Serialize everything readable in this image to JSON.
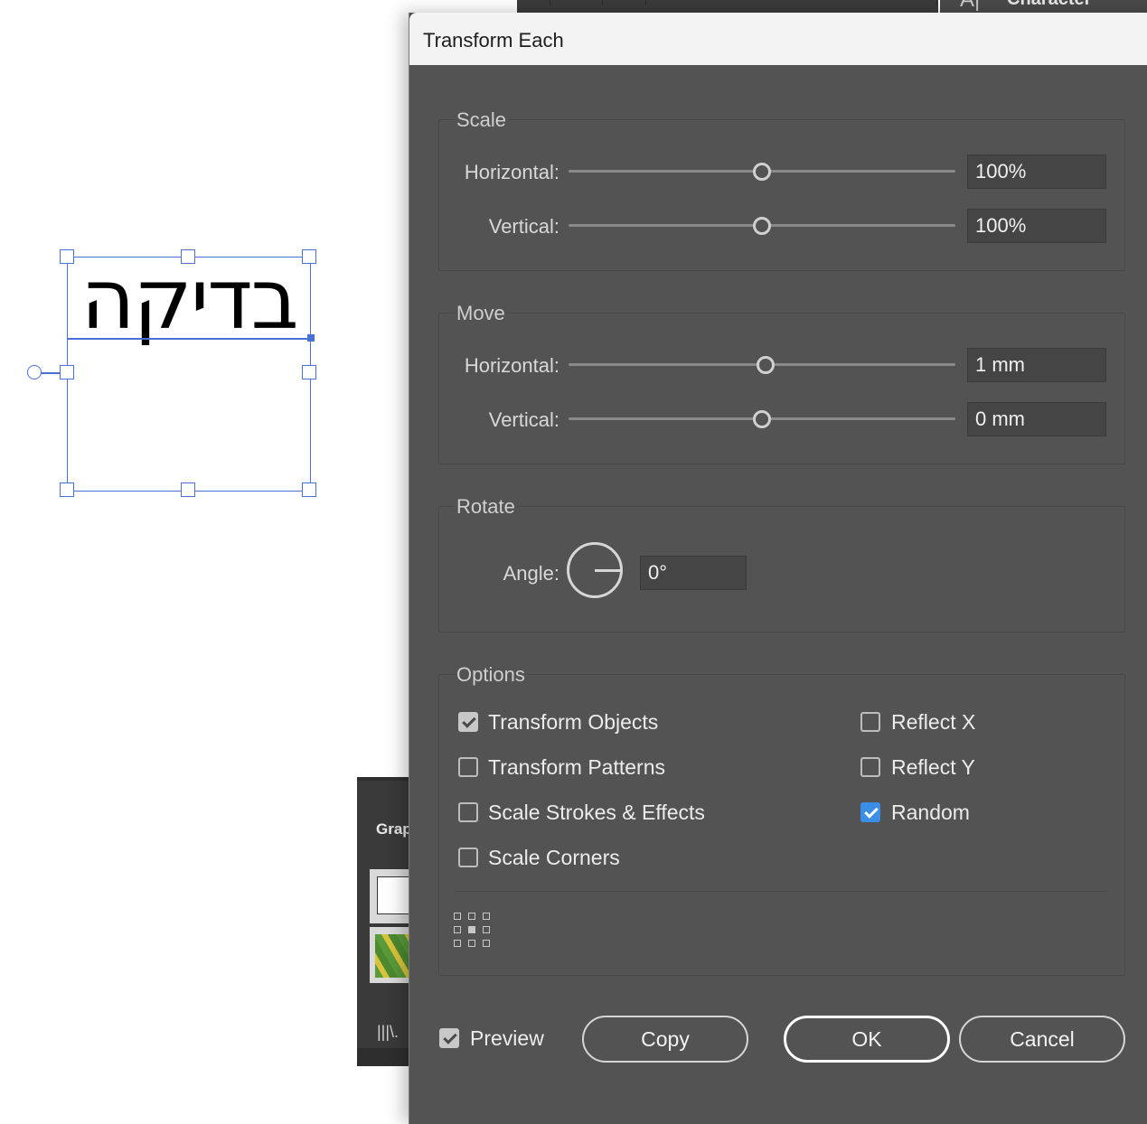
{
  "canvas": {
    "text_object": "בדיקה"
  },
  "background": {
    "character_panel_title": "Character",
    "character_panel_glyph": "A|",
    "graphic_styles_panel_title": "Grap",
    "library_icon": "|||\\."
  },
  "dialog": {
    "title": "Transform Each",
    "scale": {
      "label": "Scale",
      "horizontal_label": "Horizontal:",
      "horizontal_value": "100%",
      "vertical_label": "Vertical:",
      "vertical_value": "100%"
    },
    "move": {
      "label": "Move",
      "horizontal_label": "Horizontal:",
      "horizontal_value": "1 mm",
      "vertical_label": "Vertical:",
      "vertical_value": "0 mm"
    },
    "rotate": {
      "label": "Rotate",
      "angle_label": "Angle:",
      "angle_value": "0°"
    },
    "options": {
      "label": "Options",
      "transform_objects": {
        "label": "Transform Objects",
        "checked": true
      },
      "transform_patterns": {
        "label": "Transform Patterns",
        "checked": false
      },
      "scale_strokes": {
        "label": "Scale Strokes & Effects",
        "checked": false
      },
      "scale_corners": {
        "label": "Scale Corners",
        "checked": false
      },
      "reflect_x": {
        "label": "Reflect X",
        "checked": false
      },
      "reflect_y": {
        "label": "Reflect Y",
        "checked": false
      },
      "random": {
        "label": "Random",
        "checked": true
      }
    },
    "preview": {
      "label": "Preview",
      "checked": true
    },
    "buttons": {
      "copy": "Copy",
      "ok": "OK",
      "cancel": "Cancel"
    }
  },
  "colors": {
    "selection": "#4a6fd6",
    "dialog_bg": "#535353",
    "checkbox_blue": "#3b8ee6"
  }
}
